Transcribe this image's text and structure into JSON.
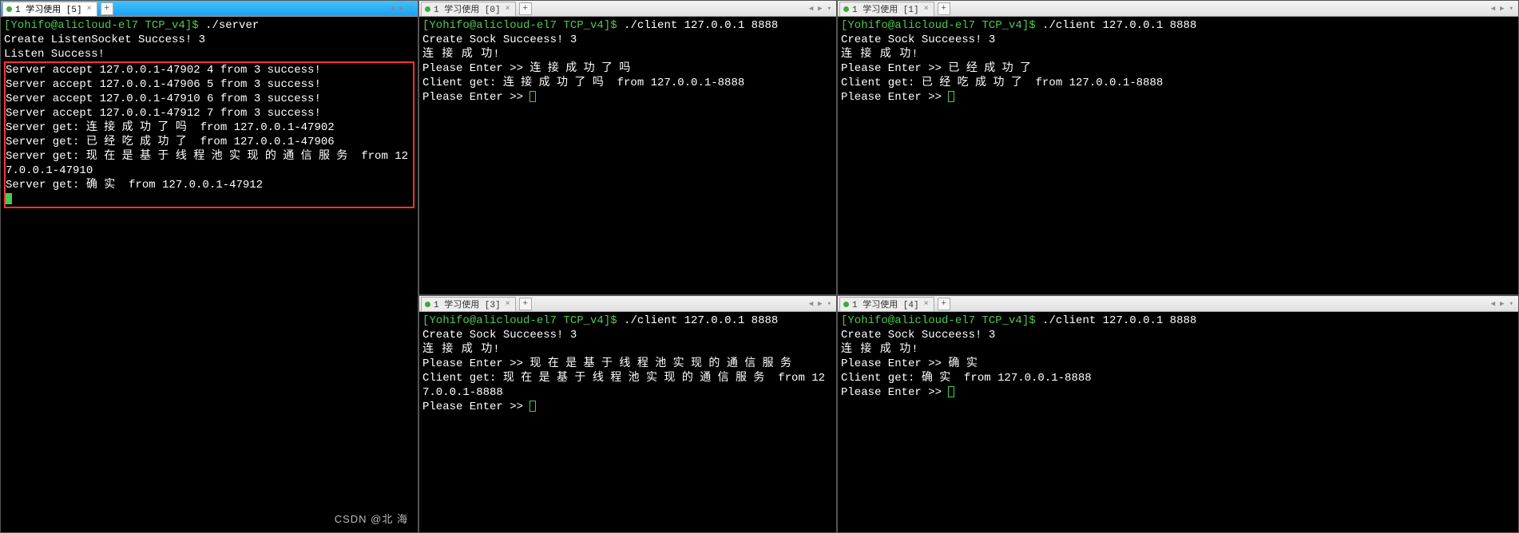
{
  "panes": [
    {
      "id": "p0",
      "tab": "1 学习使用 [0]",
      "active": false,
      "prompt": "[Yohifo@alicloud-el7 TCP_v4]$ ",
      "cmd": "./client 127.0.0.1 8888",
      "lines": [
        "Create Sock Succeess! 3",
        "连 接 成 功!",
        "Please Enter >> 连 接 成 功 了 吗",
        "Client get: 连 接 成 功 了 吗  from 127.0.0.1-8888",
        "Please Enter >> "
      ]
    },
    {
      "id": "p1",
      "tab": "1 学习使用 [1]",
      "active": false,
      "prompt": "[Yohifo@alicloud-el7 TCP_v4]$ ",
      "cmd": "./client 127.0.0.1 8888",
      "lines": [
        "Create Sock Succeess! 3",
        "连 接 成 功!",
        "Please Enter >> 已 经 成 功 了",
        "Client get: 已 经 吃 成 功 了  from 127.0.0.1-8888",
        "Please Enter >> "
      ]
    },
    {
      "id": "p5",
      "tab": "1 学习使用 [5]",
      "active": true,
      "prompt": "[Yohifo@alicloud-el7 TCP_v4]$ ",
      "cmd": "./server",
      "pre": [
        "Create ListenSocket Success! 3",
        "Listen Success!"
      ],
      "boxed": [
        "Server accept 127.0.0.1-47902 4 from 3 success!",
        "Server accept 127.0.0.1-47906 5 from 3 success!",
        "Server accept 127.0.0.1-47910 6 from 3 success!",
        "Server accept 127.0.0.1-47912 7 from 3 success!",
        "Server get: 连 接 成 功 了 吗  from 127.0.0.1-47902",
        "Server get: 已 经 吃 成 功 了  from 127.0.0.1-47906",
        "Server get: 现 在 是 基 于 线 程 池 实 现 的 通 信 服 务  from 127.0.0.1-47910",
        "Server get: 确 实  from 127.0.0.1-47912"
      ]
    },
    {
      "id": "p3",
      "tab": "1 学习使用 [3]",
      "active": false,
      "prompt": "[Yohifo@alicloud-el7 TCP_v4]$ ",
      "cmd": "./client 127.0.0.1 8888",
      "lines": [
        "Create Sock Succeess! 3",
        "连 接 成 功!",
        "Please Enter >> 现 在 是 基 于 线 程 池 实 现 的 通 信 服 务",
        "Client get: 现 在 是 基 于 线 程 池 实 现 的 通 信 服 务  from 127.0.0.1-8888",
        "Please Enter >> "
      ]
    },
    {
      "id": "p4",
      "tab": "1 学习使用 [4]",
      "active": false,
      "prompt": "[Yohifo@alicloud-el7 TCP_v4]$ ",
      "cmd": "./client 127.0.0.1 8888",
      "lines": [
        "Create Sock Succeess! 3",
        "连 接 成 功!",
        "Please Enter >> 确 实",
        "Client get: 确 实  from 127.0.0.1-8888",
        "Please Enter >> "
      ]
    }
  ],
  "watermark": "CSDN @北  海"
}
